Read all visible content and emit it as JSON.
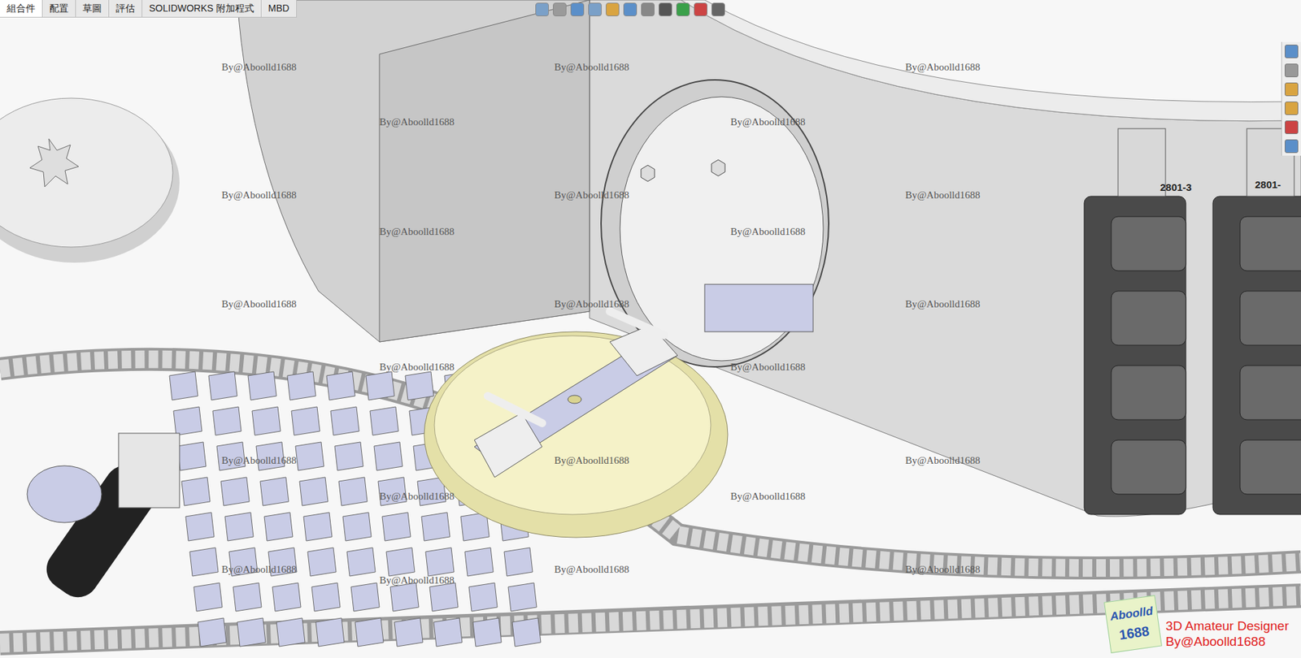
{
  "window": {
    "app": "SOLIDWORKS"
  },
  "tabs": [
    {
      "label": "組合件",
      "selected": true
    },
    {
      "label": "配置",
      "selected": false
    },
    {
      "label": "草圖",
      "selected": false
    },
    {
      "label": "評估",
      "selected": false
    },
    {
      "label": "SOLIDWORKS 附加程式",
      "selected": false
    },
    {
      "label": "MBD",
      "selected": false
    }
  ],
  "watermarks": [
    "By@Aboolld1688",
    "By@Aboolld1688",
    "By@Aboolld1688",
    "By@Aboolld1688",
    "By@Aboolld1688",
    "By@Aboolld1688",
    "By@Aboolld1688",
    "By@Aboolld1688",
    "By@Aboolld1688",
    "By@Aboolld1688",
    "By@Aboolld1688",
    "By@Aboolld1688",
    "By@Aboolld1688",
    "By@Aboolld1688",
    "By@Aboolld1688",
    "By@Aboolld1688",
    "By@Aboolld1688",
    "By@Aboolld1688",
    "By@Aboolld1688",
    "By@Aboolld1688",
    "By@Aboolld1688",
    "By@Aboolld1688",
    "By@Aboolld1688",
    "By@Aboolld1688"
  ],
  "part_labels": [
    "2801-3",
    "2801-"
  ],
  "logo": {
    "word": "Aboolld",
    "number": "1688",
    "title": "3D Amateur Designer",
    "byline": "By@Aboolld1688"
  }
}
